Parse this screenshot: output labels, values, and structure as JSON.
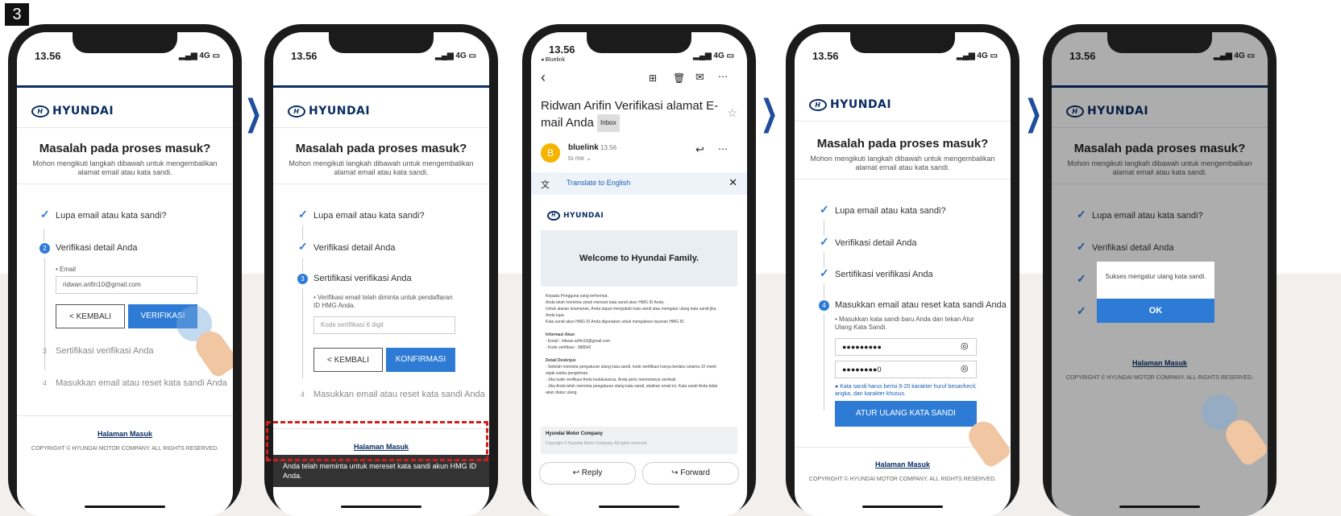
{
  "step_number": "3",
  "status": {
    "time": "13.56",
    "signal": "4G",
    "back_app": "◂ Bluelink"
  },
  "brand": "HYUNDAI",
  "page": {
    "title": "Masalah pada proses masuk?",
    "subtitle": "Mohon mengikuti langkah dibawah untuk mengembalikan alamat email atau kata sandi."
  },
  "steps": {
    "s1": "Lupa email atau kata sandi?",
    "s2": "Verifikasi detail Anda",
    "s3": "Sertifikasi verifikasi Anda",
    "s4": "Masukkan email atau reset kata sandi Anda"
  },
  "step_nums": {
    "n2": "2",
    "n3": "3",
    "n4": "4"
  },
  "screen1": {
    "email_label": "• Email",
    "email_value": "ridwan.arifin10@gmail.com",
    "back_btn": "< KEMBALI",
    "verify_btn": "VERIFIKASI"
  },
  "screen2": {
    "notice": "• Verifikasi email telah diminta untuk pendaftaran ID HMG Anda.",
    "code_placeholder": "Kode sertifikasi 6 digit",
    "back_btn": "< KEMBALI",
    "confirm_btn": "KONFIRMASI",
    "toast": "Anda telah meminta untuk mereset kata sandi akun HMG ID Anda."
  },
  "screen3": {
    "subject": "Ridwan Arifin Verifikasi alamat E-mail Anda",
    "inbox": "Inbox",
    "sender": "bluelink",
    "sent_time": "13.56",
    "to": "to me ⌄",
    "avatar": "B",
    "translate": "Translate to English",
    "banner": "Welcome to Hyundai Family.",
    "body1": "Kepada Pengguna yang terhormat,",
    "body2": "Anda telah meminta untuk mereset kata sandi akun HMG ID Anda.",
    "body3": "Untuk alasan keamanan, Anda dapat mengubah kata sandi atau mengatur ulang kata sandi jika Anda lupa.",
    "body4": "Kata sandi akun HMG ID Anda digunakan untuk mengakses layanan HMG ID.",
    "info_head": "Informasi Akun",
    "info_email": "- Email : ridwan.arifin10@gmail.com",
    "info_code": "- Kode verifikasi : 088642",
    "desc_head": "Detail Deskripsi",
    "desc1": "- Setelah meminta pengaturan ulang kata sandi, kode sertifikasi hanya berlaku selama 10 menit sejak waktu pengiriman.",
    "desc2": "- Jika kode verifikasi Anda kedaluwarsa, Anda perlu memintanya sembali.",
    "desc3": "- Jika Anda telah meminta pengaturan ulang kata sandi, abaikan email ini. Kata sandi Anda tidak akan diatur ulang.",
    "company": "Hyundai Motor Company",
    "company_copy": "Copyright © Hyundai Motor Company. All rights reserved.",
    "reply": "Reply",
    "forward": "Forward"
  },
  "screen4": {
    "instruction": "• Masukkan kata sandi baru Anda dan tekan Atur Ulang Kata Sandi.",
    "pw1": "●●●●●●●●●",
    "pw2": "●●●●●●●●0",
    "hint": "Kata sandi harus berisi 8-20 karakter huruf besar/kecil, angka, dan karakter khusus.",
    "reset_btn": "ATUR ULANG KATA SANDI"
  },
  "screen5": {
    "dialog_text": "Sukses mengatur ulang kata sandi.",
    "ok": "OK"
  },
  "footer": {
    "link": "Halaman Masuk",
    "copyright": "COPYRIGHT © HYUNDAI MOTOR COMPANY. ALL RIGHTS RESERVED."
  }
}
